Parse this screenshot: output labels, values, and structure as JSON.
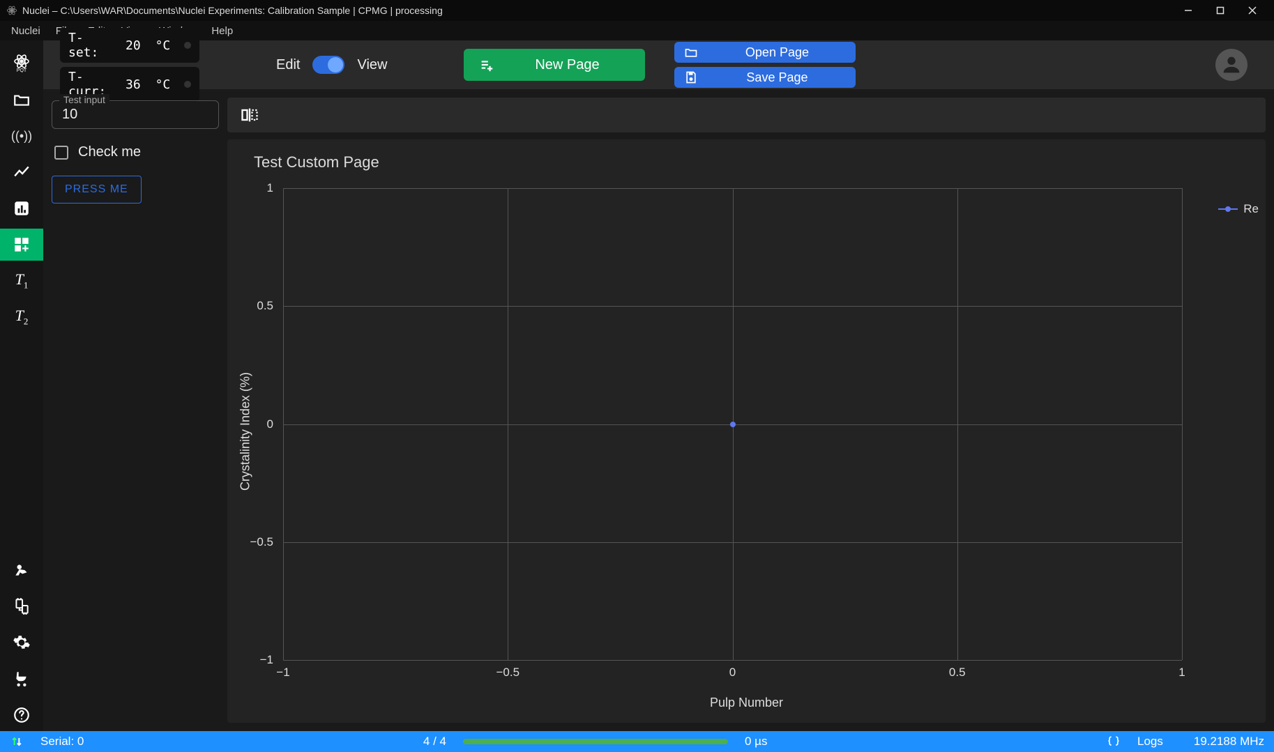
{
  "window": {
    "title": "Nuclei – C:\\Users\\WAR\\Documents\\Nuclei Experiments: Calibration Sample | CPMG | processing"
  },
  "menubar": {
    "items": [
      "Nuclei",
      "File",
      "Edit",
      "View",
      "Window",
      "Help"
    ]
  },
  "sidebar": {
    "items": [
      {
        "name": "pulse-seq-icon"
      },
      {
        "name": "folder-icon"
      },
      {
        "name": "signal-icon"
      },
      {
        "name": "line-chart-icon"
      },
      {
        "name": "bar-chart-icon"
      },
      {
        "name": "grid-add-icon",
        "active": true
      },
      {
        "name": "t1-icon",
        "text": "T",
        "sub": "1"
      },
      {
        "name": "t2-icon",
        "text": "T",
        "sub": "2"
      }
    ],
    "bottom": [
      {
        "name": "dig-icon"
      },
      {
        "name": "hardware-icon"
      },
      {
        "name": "gear-icon"
      },
      {
        "name": "stroller-icon"
      },
      {
        "name": "help-icon"
      }
    ]
  },
  "toolbar": {
    "tset_label": "T-set:",
    "tset_value": "20",
    "tset_unit": "°C",
    "tcurr_label": "T-curr:",
    "tcurr_value": "36",
    "tcurr_unit": "°C",
    "edit_label": "Edit",
    "view_label": "View",
    "new_page_label": "New Page",
    "open_page_label": "Open Page",
    "save_page_label": "Save Page"
  },
  "left_panel": {
    "test_input_label": "Test input",
    "test_input_value": "10",
    "check_label": "Check me",
    "press_label": "PRESS ME"
  },
  "chart_data": {
    "type": "scatter",
    "title": "Test Custom Page",
    "xlabel": "Pulp Number",
    "ylabel": "Crystalinity Index (%)",
    "xlim": [
      -1,
      1
    ],
    "ylim": [
      -1,
      1
    ],
    "xticks": [
      -1,
      -0.5,
      0,
      0.5,
      1
    ],
    "yticks": [
      -1,
      -0.5,
      0,
      0.5,
      1
    ],
    "series": [
      {
        "name": "Re",
        "x": [
          0
        ],
        "y": [
          0
        ]
      }
    ]
  },
  "statusbar": {
    "serial": "Serial: 0",
    "progress": "4 / 4",
    "time": "0 µs",
    "logs_label": "Logs",
    "freq": "19.2188 MHz"
  },
  "ticks": {
    "yt0": "1",
    "yt1": "0.5",
    "yt2": "0",
    "yt3": "−0.5",
    "yt4": "−1",
    "xt0": "−1",
    "xt1": "−0.5",
    "xt2": "0",
    "xt3": "0.5",
    "xt4": "1"
  }
}
